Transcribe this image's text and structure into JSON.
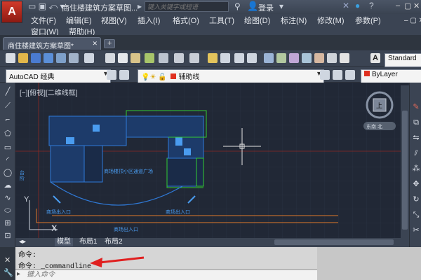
{
  "titlebar": {
    "doc_title": "商住楼建筑方案草图...",
    "search_placeholder": "键入关键字或短语",
    "login": "登录"
  },
  "menu": [
    "文件(F)",
    "编辑(E)",
    "视图(V)",
    "插入(I)",
    "格式(O)",
    "工具(T)",
    "绘图(D)",
    "标注(N)",
    "修改(M)",
    "参数(P)",
    "窗口(W)",
    "帮助(H)"
  ],
  "tab": {
    "doc": "商住楼建筑方案草图*"
  },
  "toolbar1": {
    "text_style": "Standard"
  },
  "toolbar2": {
    "workspace": "AutoCAD 经典",
    "layer": "辅助线",
    "color": "ByLayer"
  },
  "viewport": {
    "label": "[−][俯视][二维线框]",
    "center_label": "商场楼顶小区通道广场",
    "entrance_left": "商场出入口",
    "entrance_right": "商场出入口",
    "entrance_bottom": "商场出入口",
    "side_label": "台阶",
    "nav_cube": "上",
    "nav_wcs": "东南 北",
    "axis_y": "Y",
    "axis_x": "X"
  },
  "layout_tabs": [
    "模型",
    "布局1",
    "布局2"
  ],
  "command": {
    "line1": "命令:",
    "line2": "命令: _commandline",
    "placeholder": "键入命令"
  },
  "colors": {
    "canvas": "#212836",
    "building_blue": "#2f7ad8",
    "building_green": "#33cc33",
    "guide_red": "#c0392b",
    "arrow_red": "#e02020"
  }
}
